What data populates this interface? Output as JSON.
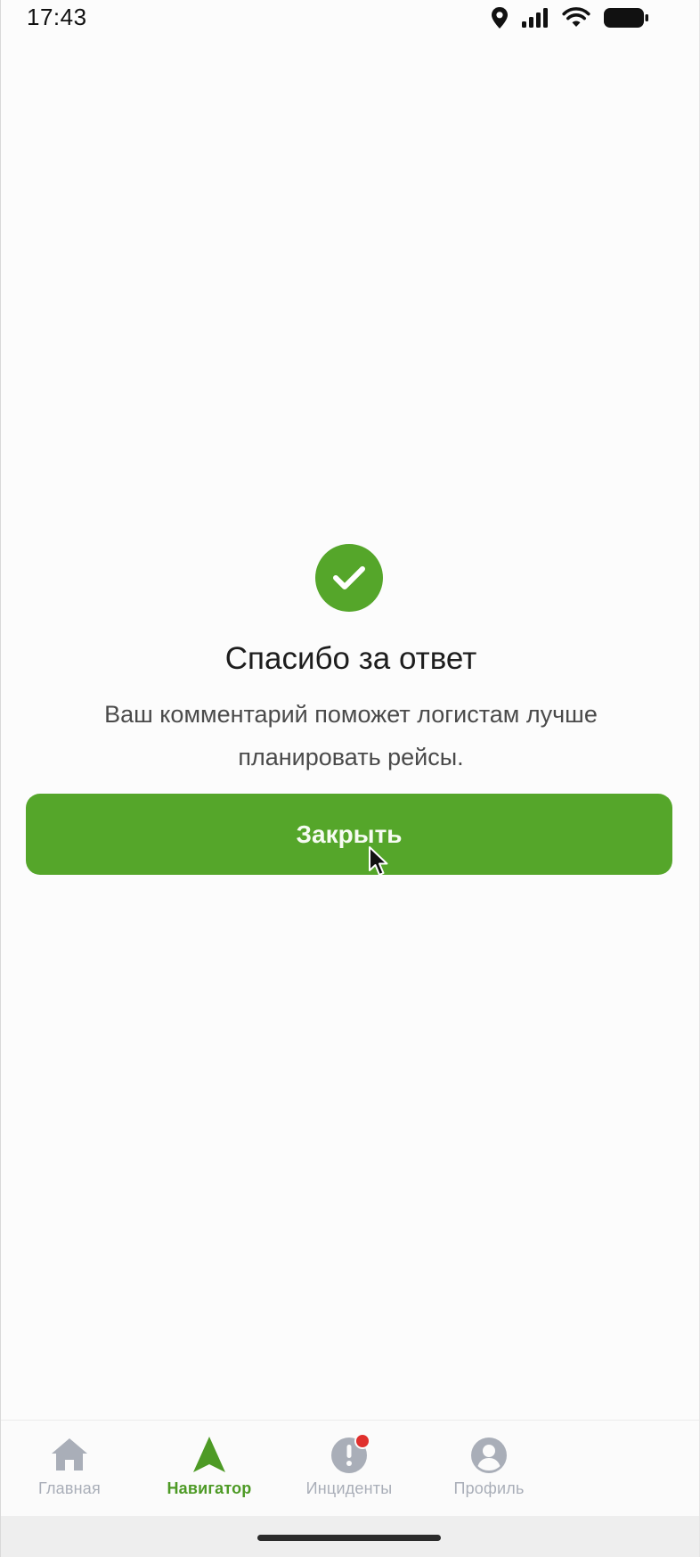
{
  "status_bar": {
    "time": "17:43",
    "icons": [
      "location-icon",
      "signal-icon",
      "wifi-icon",
      "battery-icon"
    ]
  },
  "result": {
    "icon": "check-circle-icon",
    "title": "Спасибо за ответ",
    "message_line1": "Ваш комментарий поможет логистам лучше",
    "message_line2": "планировать рейсы.",
    "close_label": "Закрыть"
  },
  "bottom_nav": {
    "items": [
      {
        "label": "Главная",
        "icon": "home-icon",
        "active": false
      },
      {
        "label": "Навигатор",
        "icon": "navigation-arrow-icon",
        "active": true
      },
      {
        "label": "Инциденты",
        "icon": "alert-icon",
        "active": false,
        "badge": true
      },
      {
        "label": "Профиль",
        "icon": "profile-icon",
        "active": false
      }
    ]
  },
  "colors": {
    "accent": "#55a62a",
    "active_nav": "#4d9a25",
    "inactive_nav": "#a9aeb8",
    "badge": "#e0302d"
  }
}
